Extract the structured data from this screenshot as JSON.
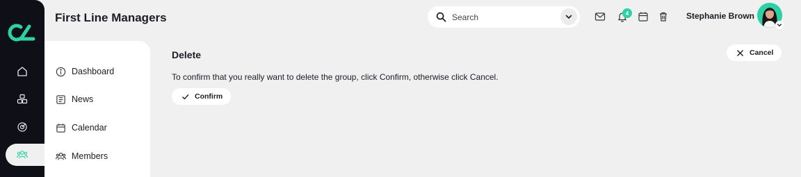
{
  "app": {
    "page_title": "First Line Managers"
  },
  "header": {
    "search_placeholder": "Search",
    "notification_count": "4",
    "user_name": "Stephanie Brown"
  },
  "rail": {
    "items": [
      {
        "icon": "home-icon"
      },
      {
        "icon": "groups-icon"
      },
      {
        "icon": "target-icon"
      },
      {
        "icon": "members-icon",
        "active": true
      }
    ]
  },
  "subnav": {
    "items": [
      {
        "label": "Dashboard",
        "icon": "info-icon"
      },
      {
        "label": "News",
        "icon": "news-icon"
      },
      {
        "label": "Calendar",
        "icon": "calendar-icon"
      },
      {
        "label": "Members",
        "icon": "members-icon"
      }
    ]
  },
  "main": {
    "title": "Delete",
    "message": "To confirm that you really want to delete the group, click Confirm, otherwise click Cancel.",
    "confirm_label": "Confirm",
    "cancel_label": "Cancel"
  },
  "colors": {
    "accent": "#2ed1a6",
    "rail": "#0f0f17",
    "background": "#f0f0f1"
  }
}
